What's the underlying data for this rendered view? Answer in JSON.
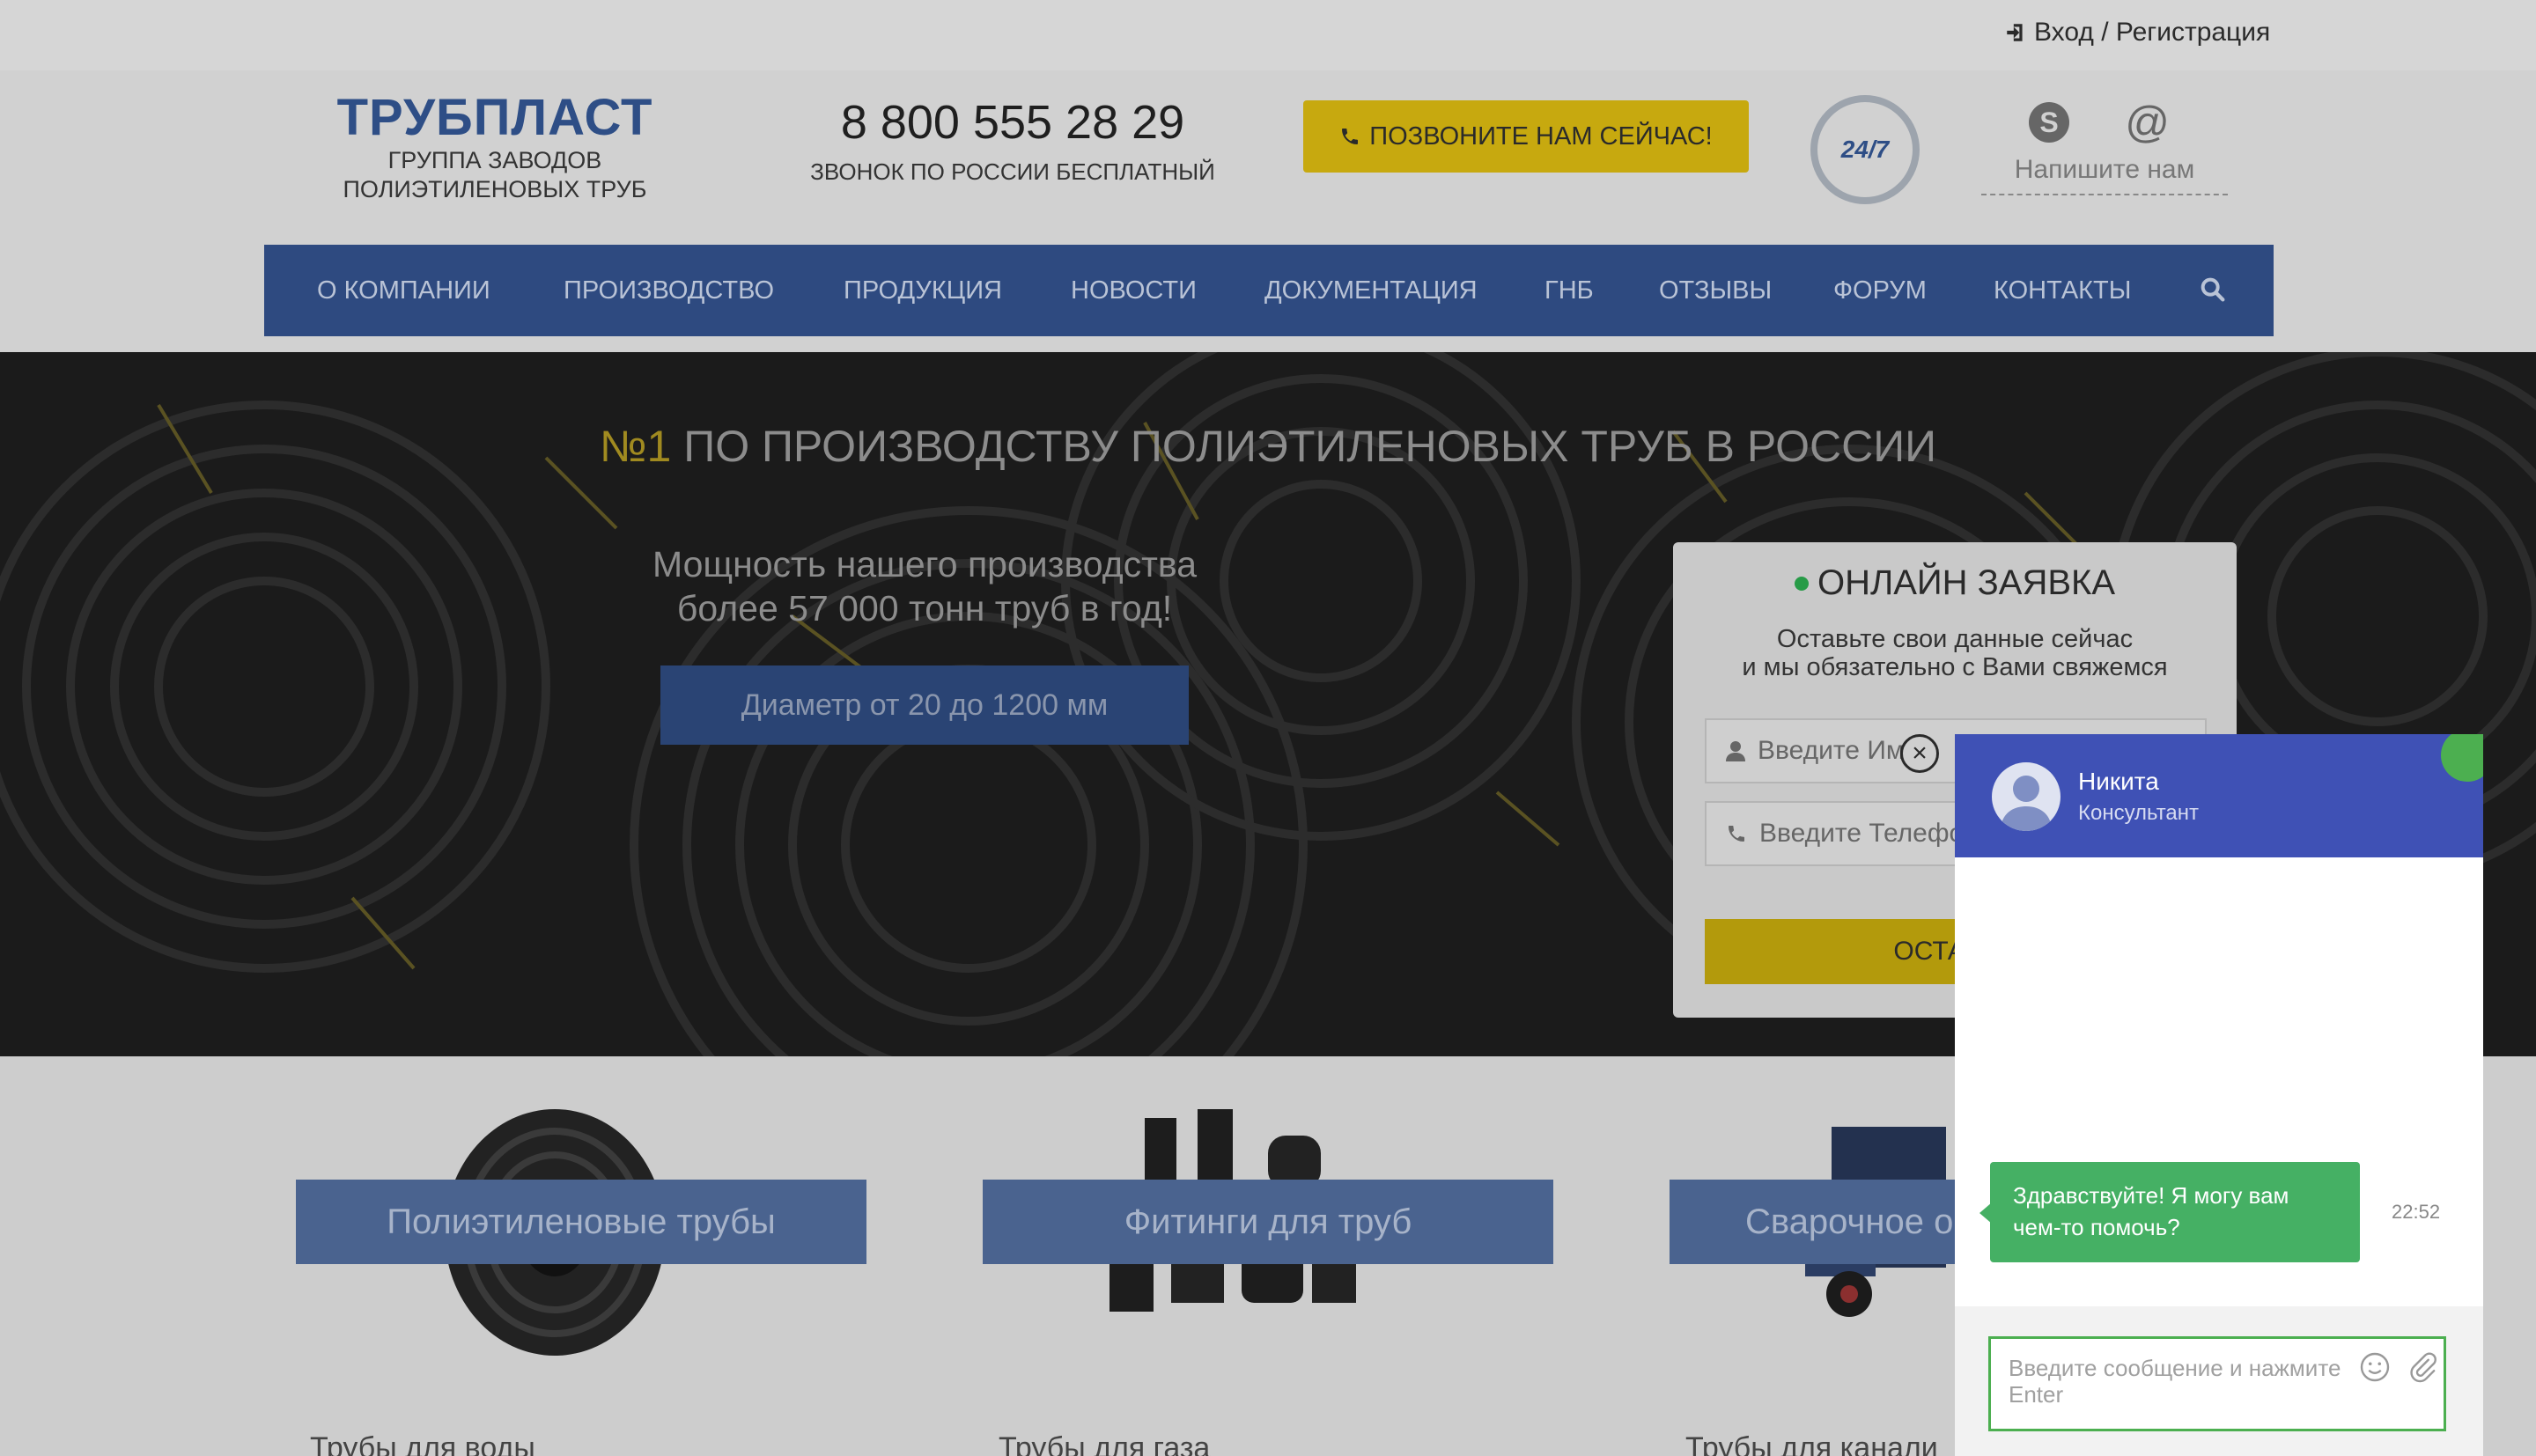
{
  "topbar": {
    "login_text": "Вход / Регистрация"
  },
  "header": {
    "logo_title": "ТРУБПЛАСТ",
    "logo_sub_1": "ГРУППА ЗАВОДОВ",
    "logo_sub_2": "ПОЛИЭТИЛЕНОВЫХ ТРУБ",
    "phone": "8 800 555 28 29",
    "phone_sub": "ЗВОНОК ПО РОССИИ БЕСПЛАТНЫЙ",
    "call_button": "ПОЗВОНИТЕ НАМ СЕЙЧАС!",
    "badge_247": "24/7",
    "write_us": "Напишите нам"
  },
  "nav": {
    "items": [
      "О КОМПАНИИ",
      "ПРОИЗВОДСТВО",
      "ПРОДУКЦИЯ",
      "НОВОСТИ",
      "ДОКУМЕНТАЦИЯ",
      "ГНБ",
      "ОТЗЫВЫ",
      "ФОРУМ",
      "КОНТАКТЫ"
    ]
  },
  "hero": {
    "title_num": "№1",
    "title_rest": " ПО ПРОИЗВОДСТВУ ПОЛИЭТИЛЕНОВЫХ ТРУБ В РОССИИ",
    "sub_1": "Мощность нашего производства",
    "sub_2": "более 57 000 тонн труб в год!",
    "button": "Диаметр от 20 до 1200 мм"
  },
  "form": {
    "title": "ОНЛАЙН ЗАЯВКА",
    "desc_1": "Оставьте свои данные сейчас",
    "desc_2": "и мы обязательно с Вами свяжемся",
    "name_placeholder": "Введите Им",
    "phone_placeholder": "Введите Телефо",
    "submit": "ОСТАВИТ"
  },
  "products": [
    {
      "label": "Полиэтиленовые трубы",
      "caption": "Трубы для воды"
    },
    {
      "label": "Фитинги для труб",
      "caption": "Трубы для газа"
    },
    {
      "label": "Сварочное о",
      "caption": "Трубы для канали"
    }
  ],
  "chat": {
    "agent_name": "Никита",
    "agent_role": "Консультант",
    "message": "Здравствуйте! Я могу вам чем-то помочь?",
    "time": "22:52",
    "input_placeholder": "Введите сообщение и нажмите Enter",
    "accent": "#3f51b5",
    "bubble_color": "#45b064"
  },
  "colors": {
    "nav_bg": "#2e4a80",
    "brand_blue": "#2e4e86",
    "accent_yellow": "#c7a90f"
  }
}
